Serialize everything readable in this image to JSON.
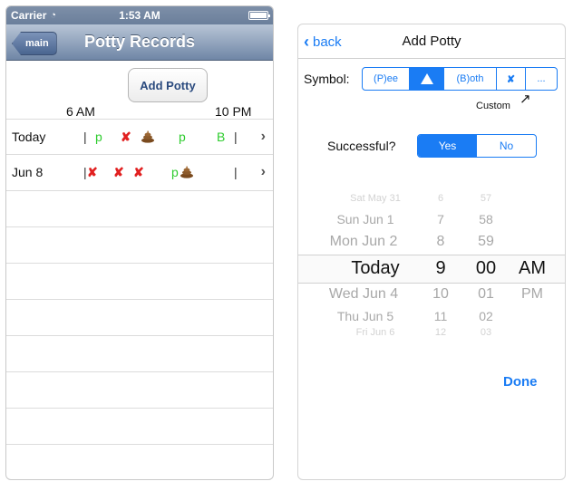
{
  "left": {
    "status": {
      "carrier": "Carrier",
      "time": "1:53 AM"
    },
    "nav": {
      "back_label": "main",
      "title": "Potty Records"
    },
    "add_potty_label": "Add Potty",
    "hours": {
      "start": "6 AM",
      "end": "10 PM"
    },
    "rows": [
      {
        "date": "Today"
      },
      {
        "date": "Jun 8"
      }
    ],
    "marks": {
      "pee": "p",
      "miss": "✘",
      "both": "B",
      "bar": "|",
      "chevron": "›"
    }
  },
  "right": {
    "nav": {
      "back_label": "back",
      "title": "Add Potty"
    },
    "symbol_label": "Symbol:",
    "symbol_options": [
      "(P)ee",
      "",
      "(B)oth",
      "✘",
      "..."
    ],
    "custom_label": "Custom",
    "successful_label": "Successful?",
    "successful_options": [
      "Yes",
      "No"
    ],
    "picker": {
      "dates": [
        "Sat May 31",
        "Sun Jun 1",
        "Mon Jun 2",
        "Today",
        "Wed Jun 4",
        "Thu Jun 5",
        "Fri Jun 6"
      ],
      "hours": [
        "6",
        "7",
        "8",
        "9",
        "10",
        "11",
        "12"
      ],
      "minutes": [
        "57",
        "58",
        "59",
        "00",
        "01",
        "02",
        "03"
      ],
      "ampm": [
        "AM",
        "PM"
      ]
    },
    "done_label": "Done"
  },
  "colors": {
    "ios_blue": "#1a7cf4",
    "pee_green": "#2ecc2e",
    "miss_red": "#e12020"
  }
}
